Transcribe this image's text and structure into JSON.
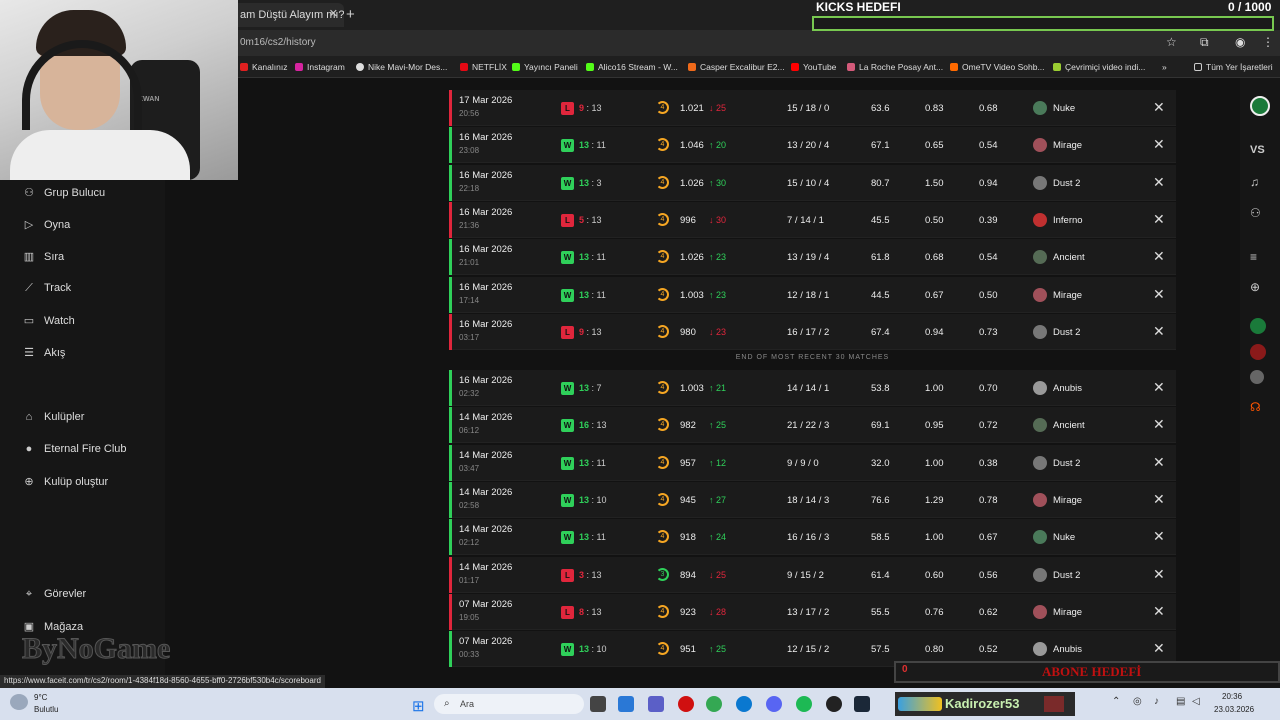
{
  "browser": {
    "tab_title": "am Düştü Alayım mı?",
    "url": "0m16/cs2/history",
    "status_url": "https://www.faceit.com/tr/cs2/room/1-4384f18d-8560-4655-bff0-2726bf530b4c/scoreboard",
    "bookmarks": [
      "Kanalınız",
      "Instagram",
      "Nike Mavi-Mor Des...",
      "NETFLİX",
      "Yayıncı Paneli",
      "Alico16 Stream - W...",
      "Casper Excalibur E2...",
      "YouTube",
      "La Roche Posay Ant...",
      "OmeTV Video Sohb...",
      "Çevrimiçi video indi..."
    ],
    "bookmarks_more": "»",
    "all_bookmarks": "Tüm Yer İşaretleri"
  },
  "overlay": {
    "kicks_title": "KICKS HEDEFI",
    "kicks_count": "0 / 1000",
    "kicks_progress": 0,
    "abone_title": "ABONE HEDEFİ",
    "abone_count": "0",
    "chair_text": "KWAN",
    "logo": "ByNoGame"
  },
  "sidebar": {
    "items": [
      {
        "label": "Grup Bulucu",
        "icon": "users-icon"
      },
      {
        "label": "Oyna",
        "icon": "play-icon"
      },
      {
        "label": "Sıra",
        "icon": "ranking-icon"
      },
      {
        "label": "Track",
        "icon": "chart-icon"
      },
      {
        "label": "Watch",
        "icon": "video-icon"
      },
      {
        "label": "Akış",
        "icon": "feed-icon"
      },
      {
        "label": "Kulüpler",
        "icon": "club-icon"
      },
      {
        "label": "Eternal Fire Club",
        "icon": "eternal-fire-icon"
      },
      {
        "label": "Kulüp oluştur",
        "icon": "add-circle-icon"
      },
      {
        "label": "Görevler",
        "icon": "missions-icon"
      },
      {
        "label": "Mağaza",
        "icon": "shop-icon"
      }
    ]
  },
  "rail": {
    "vs": "VS"
  },
  "matches_recent": [
    {
      "date": "17 Mar 2026",
      "time": "20:56",
      "result": "L",
      "score_a": "9",
      "score_b": "13",
      "level": "4",
      "elo": "1.021",
      "delta": "25",
      "dir": "down",
      "kda": "15 / 18 / 0",
      "adr": "63.6",
      "kd": "0.83",
      "kr": "0.68",
      "map": "Nuke"
    },
    {
      "date": "16 Mar 2026",
      "time": "23:08",
      "result": "W",
      "score_a": "13",
      "score_b": "11",
      "level": "4",
      "elo": "1.046",
      "delta": "20",
      "dir": "up",
      "kda": "13 / 20 / 4",
      "adr": "67.1",
      "kd": "0.65",
      "kr": "0.54",
      "map": "Mirage"
    },
    {
      "date": "16 Mar 2026",
      "time": "22:18",
      "result": "W",
      "score_a": "13",
      "score_b": "3",
      "level": "4",
      "elo": "1.026",
      "delta": "30",
      "dir": "up",
      "kda": "15 / 10 / 4",
      "adr": "80.7",
      "kd": "1.50",
      "kr": "0.94",
      "map": "Dust 2"
    },
    {
      "date": "16 Mar 2026",
      "time": "21:36",
      "result": "L",
      "score_a": "5",
      "score_b": "13",
      "level": "4",
      "elo": "996",
      "delta": "30",
      "dir": "down",
      "kda": "7 / 14 / 1",
      "adr": "45.5",
      "kd": "0.50",
      "kr": "0.39",
      "map": "Inferno"
    },
    {
      "date": "16 Mar 2026",
      "time": "21:01",
      "result": "W",
      "score_a": "13",
      "score_b": "11",
      "level": "4",
      "elo": "1.026",
      "delta": "23",
      "dir": "up",
      "kda": "13 / 19 / 4",
      "adr": "61.8",
      "kd": "0.68",
      "kr": "0.54",
      "map": "Ancient"
    },
    {
      "date": "16 Mar 2026",
      "time": "17:14",
      "result": "W",
      "score_a": "13",
      "score_b": "11",
      "level": "4",
      "elo": "1.003",
      "delta": "23",
      "dir": "up",
      "kda": "12 / 18 / 1",
      "adr": "44.5",
      "kd": "0.67",
      "kr": "0.50",
      "map": "Mirage"
    },
    {
      "date": "16 Mar 2026",
      "time": "03:17",
      "result": "L",
      "score_a": "9",
      "score_b": "13",
      "level": "4",
      "elo": "980",
      "delta": "23",
      "dir": "down",
      "kda": "16 / 17 / 2",
      "adr": "67.4",
      "kd": "0.94",
      "kr": "0.73",
      "map": "Dust 2"
    }
  ],
  "divider": "END OF MOST RECENT 30 MATCHES",
  "matches_older": [
    {
      "date": "16 Mar 2026",
      "time": "02:32",
      "result": "W",
      "score_a": "13",
      "score_b": "7",
      "level": "4",
      "elo": "1.003",
      "delta": "21",
      "dir": "up",
      "kda": "14 / 14 / 1",
      "adr": "53.8",
      "kd": "1.00",
      "kr": "0.70",
      "map": "Anubis"
    },
    {
      "date": "14 Mar 2026",
      "time": "06:12",
      "result": "W",
      "score_a": "16",
      "score_b": "13",
      "level": "4",
      "elo": "982",
      "delta": "25",
      "dir": "up",
      "kda": "21 / 22 / 3",
      "adr": "69.1",
      "kd": "0.95",
      "kr": "0.72",
      "map": "Ancient"
    },
    {
      "date": "14 Mar 2026",
      "time": "03:47",
      "result": "W",
      "score_a": "13",
      "score_b": "11",
      "level": "4",
      "elo": "957",
      "delta": "12",
      "dir": "up",
      "kda": "9 / 9 / 0",
      "adr": "32.0",
      "kd": "1.00",
      "kr": "0.38",
      "map": "Dust 2"
    },
    {
      "date": "14 Mar 2026",
      "time": "02:58",
      "result": "W",
      "score_a": "13",
      "score_b": "10",
      "level": "4",
      "elo": "945",
      "delta": "27",
      "dir": "up",
      "kda": "18 / 14 / 3",
      "adr": "76.6",
      "kd": "1.29",
      "kr": "0.78",
      "map": "Mirage"
    },
    {
      "date": "14 Mar 2026",
      "time": "02:12",
      "result": "W",
      "score_a": "13",
      "score_b": "11",
      "level": "4",
      "elo": "918",
      "delta": "24",
      "dir": "up",
      "kda": "16 / 16 / 3",
      "adr": "58.5",
      "kd": "1.00",
      "kr": "0.67",
      "map": "Nuke"
    },
    {
      "date": "14 Mar 2026",
      "time": "01:17",
      "result": "L",
      "score_a": "3",
      "score_b": "13",
      "level": "3",
      "elo": "894",
      "delta": "25",
      "dir": "down",
      "kda": "9 / 15 / 2",
      "adr": "61.4",
      "kd": "0.60",
      "kr": "0.56",
      "map": "Dust 2"
    },
    {
      "date": "07 Mar 2026",
      "time": "19:05",
      "result": "L",
      "score_a": "8",
      "score_b": "13",
      "level": "4",
      "elo": "923",
      "delta": "28",
      "dir": "down",
      "kda": "13 / 17 / 2",
      "adr": "55.5",
      "kd": "0.76",
      "kr": "0.62",
      "map": "Mirage"
    },
    {
      "date": "07 Mar 2026",
      "time": "00:33",
      "result": "W",
      "score_a": "13",
      "score_b": "10",
      "level": "4",
      "elo": "951",
      "delta": "25",
      "dir": "up",
      "kda": "12 / 15 / 2",
      "adr": "57.5",
      "kd": "0.80",
      "kr": "0.52",
      "map": "Anubis"
    }
  ],
  "colors": {
    "win": "#2fd05a",
    "loss": "#e0263c",
    "elo_level": "#f5a623"
  },
  "taskbar": {
    "temp": "9°C",
    "weather": "Bulutlu",
    "search": "Ara",
    "user": "Kadirozer53",
    "time": "20:36",
    "date": "23.03.2026"
  }
}
